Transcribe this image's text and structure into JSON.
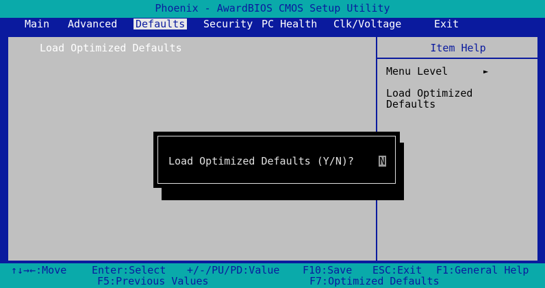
{
  "title": "Phoenix - AwardBIOS CMOS Setup Utility",
  "menu": {
    "items": [
      {
        "label": "Main"
      },
      {
        "label": "Advanced"
      },
      {
        "label": "Defaults"
      },
      {
        "label": "Security"
      },
      {
        "label": "PC Health"
      },
      {
        "label": "Clk/Voltage"
      },
      {
        "label": "Exit"
      }
    ],
    "active_index": 2
  },
  "main": {
    "option_label": "Load Optimized Defaults"
  },
  "help": {
    "title": "Item Help",
    "menu_level": "Menu Level",
    "arrow": "►",
    "description": "Load Optimized\nDefaults"
  },
  "dialog": {
    "prompt": "Load Optimized Defaults (Y/N)?",
    "value": "N"
  },
  "footer": {
    "row1": [
      {
        "label": "↑↓→←:Move"
      },
      {
        "label": "Enter:Select"
      },
      {
        "label": "+/-/PU/PD:Value"
      },
      {
        "label": "F10:Save"
      },
      {
        "label": "ESC:Exit"
      },
      {
        "label": "F1:General Help"
      }
    ],
    "row2": [
      {
        "label": "F5:Previous Values"
      },
      {
        "label": "F7:Optimized Defaults"
      }
    ]
  },
  "colors": {
    "background": "#0a1a9e",
    "cyan_bar": "#0aaaaa",
    "panel_grey": "#c0c0c0",
    "active_menu_bg": "#e8e8e8",
    "dialog_bg": "#000000"
  }
}
